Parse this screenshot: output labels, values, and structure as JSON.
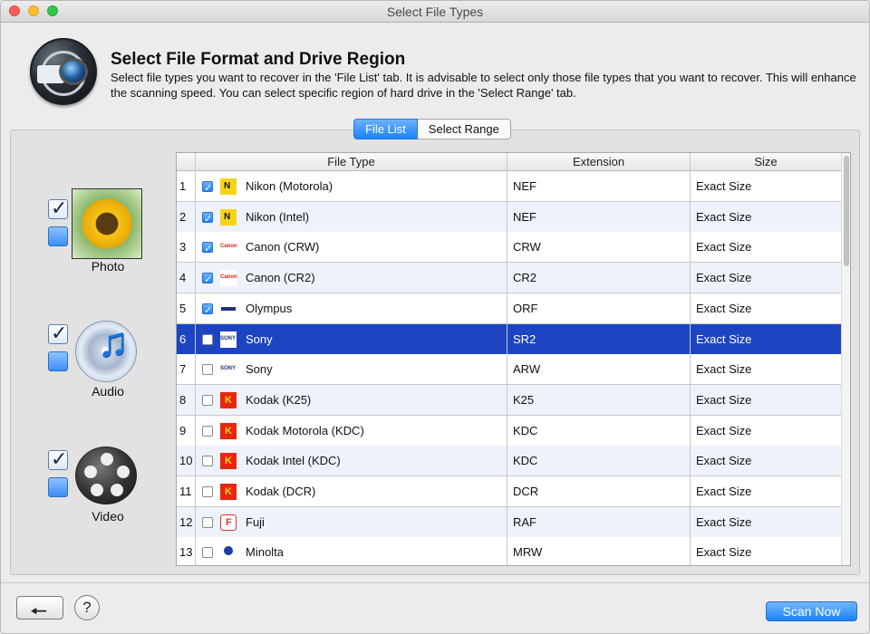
{
  "window": {
    "title": "Select File Types"
  },
  "header": {
    "title": "Select File Format and Drive Region",
    "description": "Select file types you want to recover in the 'File List' tab. It is advisable to select only those file types that you want to recover. This will enhance the scanning speed. You can select specific region of hard drive in the 'Select Range' tab."
  },
  "tabs": [
    {
      "label": "File List",
      "active": true
    },
    {
      "label": "Select Range",
      "active": false
    }
  ],
  "categories": [
    {
      "label": "Photo",
      "icon": "sunflower-icon"
    },
    {
      "label": "Audio",
      "icon": "music-disc-icon"
    },
    {
      "label": "Video",
      "icon": "film-reel-icon"
    }
  ],
  "table": {
    "columns": [
      "File Type",
      "Extension",
      "Size"
    ],
    "rows": [
      {
        "num": "1",
        "checked": true,
        "brand": "nikon",
        "type": "Nikon (Motorola)",
        "ext": "NEF",
        "size": "Exact Size"
      },
      {
        "num": "2",
        "checked": true,
        "brand": "nikon",
        "type": "Nikon (Intel)",
        "ext": "NEF",
        "size": "Exact Size"
      },
      {
        "num": "3",
        "checked": true,
        "brand": "canon",
        "type": "Canon (CRW)",
        "ext": "CRW",
        "size": "Exact Size"
      },
      {
        "num": "4",
        "checked": true,
        "brand": "canon",
        "type": "Canon (CR2)",
        "ext": "CR2",
        "size": "Exact Size"
      },
      {
        "num": "5",
        "checked": true,
        "brand": "olympus",
        "type": "Olympus",
        "ext": "ORF",
        "size": "Exact Size"
      },
      {
        "num": "6",
        "checked": false,
        "brand": "sony",
        "type": "Sony",
        "ext": "SR2",
        "size": "Exact Size",
        "selected": true
      },
      {
        "num": "7",
        "checked": false,
        "brand": "sony",
        "type": "Sony",
        "ext": "ARW",
        "size": "Exact Size"
      },
      {
        "num": "8",
        "checked": false,
        "brand": "kodak",
        "type": "Kodak (K25)",
        "ext": "K25",
        "size": "Exact Size"
      },
      {
        "num": "9",
        "checked": false,
        "brand": "kodak",
        "type": "Kodak Motorola (KDC)",
        "ext": "KDC",
        "size": "Exact Size"
      },
      {
        "num": "10",
        "checked": false,
        "brand": "kodak",
        "type": "Kodak Intel (KDC)",
        "ext": "KDC",
        "size": "Exact Size"
      },
      {
        "num": "11",
        "checked": false,
        "brand": "kodak",
        "type": "Kodak (DCR)",
        "ext": "DCR",
        "size": "Exact Size"
      },
      {
        "num": "12",
        "checked": false,
        "brand": "fuji",
        "type": "Fuji",
        "ext": "RAF",
        "size": "Exact Size"
      },
      {
        "num": "13",
        "checked": false,
        "brand": "minolta",
        "type": "Minolta",
        "ext": "MRW",
        "size": "Exact Size"
      }
    ]
  },
  "footer": {
    "back_icon": "back-arrow-icon",
    "help_label": "?",
    "scan_label": "Scan Now"
  },
  "colors": {
    "accent": "#1b83f9",
    "selected_row": "#1d45c2"
  }
}
